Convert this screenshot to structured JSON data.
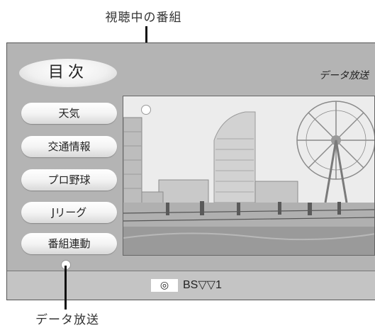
{
  "callouts": {
    "top": "視聴中の番組",
    "bottom": "データ放送"
  },
  "screen": {
    "menu_title": "目次",
    "broadcast_label": "データ放送",
    "menu_items": [
      "天気",
      "交通情報",
      "プロ野球",
      "Jリーグ",
      "番組連動"
    ],
    "channel_icon": "◎",
    "channel": "BS▽▽1"
  },
  "colors": {
    "screen_background": "#b4b4b4",
    "bottom_bar": "#c4c4c4"
  }
}
